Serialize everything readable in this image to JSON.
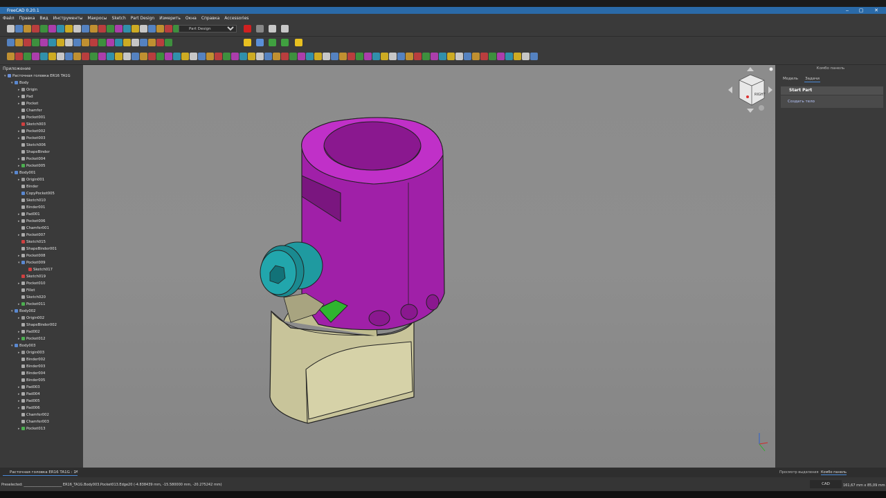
{
  "window": {
    "title": "FreeCAD 0.20.1",
    "minimize": "‒",
    "maximize": "▢",
    "close": "✕"
  },
  "menu": [
    "Файл",
    "Правка",
    "Вид",
    "Инструменты",
    "Макросы",
    "Sketch",
    "Part Design",
    "Измерить",
    "Окна",
    "Справка",
    "Accessories"
  ],
  "workbench": {
    "selected": "Part Design"
  },
  "tree": {
    "header": "Приложение",
    "items": [
      {
        "label": "Расточная головка ER16 TA1G",
        "level": 0,
        "arrow": "▾",
        "icon": "document-icon",
        "color": "#6b8fd8"
      },
      {
        "label": "Body",
        "level": 1,
        "arrow": "▾",
        "icon": "body-icon",
        "color": "#5a88d0"
      },
      {
        "label": "Origin",
        "level": 2,
        "arrow": "▸",
        "icon": "origin-icon",
        "color": "#999"
      },
      {
        "label": "Pad",
        "level": 2,
        "arrow": "▸",
        "icon": "pad-icon",
        "color": "#aaa"
      },
      {
        "label": "Pocket",
        "level": 2,
        "arrow": "▸",
        "icon": "pocket-icon",
        "color": "#aaa"
      },
      {
        "label": "Chamfer",
        "level": 2,
        "arrow": "",
        "icon": "chamfer-icon",
        "color": "#aaa"
      },
      {
        "label": "Pocket001",
        "level": 2,
        "arrow": "▸",
        "icon": "pocket-icon",
        "color": "#aaa"
      },
      {
        "label": "Sketch003",
        "level": 2,
        "arrow": "",
        "icon": "sketch-icon",
        "color": "#d04040"
      },
      {
        "label": "Pocket002",
        "level": 2,
        "arrow": "▸",
        "icon": "pocket-icon",
        "color": "#aaa"
      },
      {
        "label": "Pocket003",
        "level": 2,
        "arrow": "▸",
        "icon": "pocket-icon",
        "color": "#aaa"
      },
      {
        "label": "Sketch006",
        "level": 2,
        "arrow": "",
        "icon": "sketch-icon",
        "color": "#aaa"
      },
      {
        "label": "ShapeBinder",
        "level": 2,
        "arrow": "",
        "icon": "binder-icon",
        "color": "#aaa"
      },
      {
        "label": "Pocket004",
        "level": 2,
        "arrow": "▸",
        "icon": "pocket-icon",
        "color": "#aaa"
      },
      {
        "label": "Pocket005",
        "level": 2,
        "arrow": "▸",
        "icon": "pocket-icon",
        "color": "#4caf50"
      },
      {
        "label": "Body001",
        "level": 1,
        "arrow": "▾",
        "icon": "body-icon",
        "color": "#5a88d0"
      },
      {
        "label": "Origin001",
        "level": 2,
        "arrow": "▸",
        "icon": "origin-icon",
        "color": "#999"
      },
      {
        "label": "Binder",
        "level": 2,
        "arrow": "",
        "icon": "binder-icon",
        "color": "#aaa"
      },
      {
        "label": "CopyPocket005",
        "level": 2,
        "arrow": "",
        "icon": "binder-icon",
        "color": "#5a88d0"
      },
      {
        "label": "Sketch010",
        "level": 2,
        "arrow": "",
        "icon": "sketch-icon",
        "color": "#aaa"
      },
      {
        "label": "Binder001",
        "level": 2,
        "arrow": "",
        "icon": "binder-icon",
        "color": "#aaa"
      },
      {
        "label": "Pad001",
        "level": 2,
        "arrow": "▸",
        "icon": "pad-icon",
        "color": "#aaa"
      },
      {
        "label": "Pocket006",
        "level": 2,
        "arrow": "▸",
        "icon": "pocket-icon",
        "color": "#aaa"
      },
      {
        "label": "Chamfer001",
        "level": 2,
        "arrow": "",
        "icon": "chamfer-icon",
        "color": "#aaa"
      },
      {
        "label": "Pocket007",
        "level": 2,
        "arrow": "▸",
        "icon": "pocket-icon",
        "color": "#aaa"
      },
      {
        "label": "Sketch015",
        "level": 2,
        "arrow": "",
        "icon": "sketch-icon",
        "color": "#d04040"
      },
      {
        "label": "ShapeBinder001",
        "level": 2,
        "arrow": "",
        "icon": "binder-icon",
        "color": "#aaa"
      },
      {
        "label": "Pocket008",
        "level": 2,
        "arrow": "▸",
        "icon": "pocket-icon",
        "color": "#aaa"
      },
      {
        "label": "Pocket009",
        "level": 2,
        "arrow": "▾",
        "icon": "pocket-icon",
        "color": "#5a88d0"
      },
      {
        "label": "Sketch017",
        "level": 3,
        "arrow": "",
        "icon": "sketch-icon",
        "color": "#d04040"
      },
      {
        "label": "Sketch019",
        "level": 2,
        "arrow": "",
        "icon": "sketch-icon",
        "color": "#d04040"
      },
      {
        "label": "Pocket010",
        "level": 2,
        "arrow": "▸",
        "icon": "pocket-icon",
        "color": "#aaa"
      },
      {
        "label": "Fillet",
        "level": 2,
        "arrow": "",
        "icon": "fillet-icon",
        "color": "#aaa"
      },
      {
        "label": "Sketch020",
        "level": 2,
        "arrow": "",
        "icon": "sketch-icon",
        "color": "#aaa"
      },
      {
        "label": "Pocket011",
        "level": 2,
        "arrow": "▸",
        "icon": "pocket-icon",
        "color": "#4caf50"
      },
      {
        "label": "Body002",
        "level": 1,
        "arrow": "▾",
        "icon": "body-icon",
        "color": "#5a88d0"
      },
      {
        "label": "Origin002",
        "level": 2,
        "arrow": "▸",
        "icon": "origin-icon",
        "color": "#999"
      },
      {
        "label": "ShapeBinder002",
        "level": 2,
        "arrow": "",
        "icon": "binder-icon",
        "color": "#aaa"
      },
      {
        "label": "Pad002",
        "level": 2,
        "arrow": "▸",
        "icon": "pad-icon",
        "color": "#aaa"
      },
      {
        "label": "Pocket012",
        "level": 2,
        "arrow": "▸",
        "icon": "pocket-icon",
        "color": "#4caf50"
      },
      {
        "label": "Body003",
        "level": 1,
        "arrow": "▾",
        "icon": "body-icon",
        "color": "#5a88d0"
      },
      {
        "label": "Origin003",
        "level": 2,
        "arrow": "▸",
        "icon": "origin-icon",
        "color": "#999"
      },
      {
        "label": "Binder002",
        "level": 2,
        "arrow": "",
        "icon": "binder-icon",
        "color": "#aaa"
      },
      {
        "label": "Binder003",
        "level": 2,
        "arrow": "",
        "icon": "binder-icon",
        "color": "#aaa"
      },
      {
        "label": "Binder004",
        "level": 2,
        "arrow": "",
        "icon": "binder-icon",
        "color": "#aaa"
      },
      {
        "label": "Binder005",
        "level": 2,
        "arrow": "",
        "icon": "binder-icon",
        "color": "#aaa"
      },
      {
        "label": "Pad003",
        "level": 2,
        "arrow": "▸",
        "icon": "pad-icon",
        "color": "#aaa"
      },
      {
        "label": "Pad004",
        "level": 2,
        "arrow": "▸",
        "icon": "pad-icon",
        "color": "#aaa"
      },
      {
        "label": "Pad005",
        "level": 2,
        "arrow": "▸",
        "icon": "pad-icon",
        "color": "#aaa"
      },
      {
        "label": "Pad006",
        "level": 2,
        "arrow": "▸",
        "icon": "pad-icon",
        "color": "#aaa"
      },
      {
        "label": "Chamfer002",
        "level": 2,
        "arrow": "",
        "icon": "chamfer-icon",
        "color": "#aaa"
      },
      {
        "label": "Chamfer003",
        "level": 2,
        "arrow": "",
        "icon": "chamfer-icon",
        "color": "#aaa"
      },
      {
        "label": "Pocket013",
        "level": 2,
        "arrow": "▸",
        "icon": "pocket-icon",
        "color": "#4caf50"
      }
    ]
  },
  "navcube": {
    "face": "RIGHT"
  },
  "combo": {
    "title": "Комбо панель",
    "tabs": [
      "Модель",
      "Задачи"
    ],
    "task_header": "Start Part",
    "task_link": "Создать тело"
  },
  "doc_tab": "Расточная головка ER16 TA1G : 1*",
  "bottom_tabs": [
    "Просмотр выделения",
    "Комбо панель"
  ],
  "status": {
    "text": "Preselected: ______________________ ER16_TA1G.Body003.Pocket013.Edge20 (-4.838439 mm, -15.580000 mm, -20.275242 mm)",
    "nav_style": "CAD",
    "dims": "161,67 mm x 85,09 mm"
  },
  "colors": {
    "part_upper": "#a020a8",
    "part_lower": "#c8c49a",
    "part_screw": "#1f9aa0",
    "face_selected": "#2fb52f"
  }
}
